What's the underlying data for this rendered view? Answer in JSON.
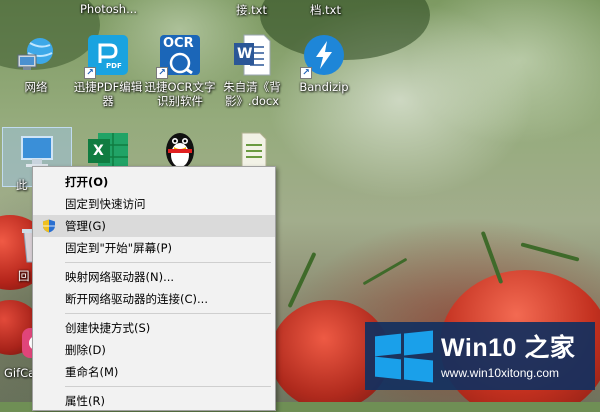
{
  "desktop": {
    "top_labels": [
      "Photosh...",
      "接.txt",
      "档.txt"
    ],
    "icons": [
      {
        "label": "网络"
      },
      {
        "label": "迅捷PDF编辑器"
      },
      {
        "label": "迅捷OCR文字识别软件"
      },
      {
        "label": "朱自清《背影》.docx"
      },
      {
        "label": "Bandizip"
      },
      {
        "label": "此"
      },
      {
        "label": "回"
      },
      {
        "label": "GifCa"
      }
    ]
  },
  "icon_texts": {
    "pdf": "PDF",
    "ocr": "OCR",
    "word": "W",
    "excel": "X"
  },
  "context_menu": {
    "items": [
      {
        "label": "打开(O)"
      },
      {
        "label": "固定到快速访问"
      },
      {
        "label": "管理(G)"
      },
      {
        "label": "固定到\"开始\"屏幕(P)"
      },
      {
        "label": "映射网络驱动器(N)..."
      },
      {
        "label": "断开网络驱动器的连接(C)..."
      },
      {
        "label": "创建快捷方式(S)"
      },
      {
        "label": "删除(D)"
      },
      {
        "label": "重命名(M)"
      },
      {
        "label": "属性(R)"
      }
    ]
  },
  "watermark": {
    "brand": "Win10 之家",
    "url": "www.win10xitong.com"
  },
  "colors": {
    "watermark_bg": "#123060",
    "windows_blue": "#1aa0ea",
    "menu_bg": "#f2f2f2",
    "menu_hover": "#dadada"
  }
}
